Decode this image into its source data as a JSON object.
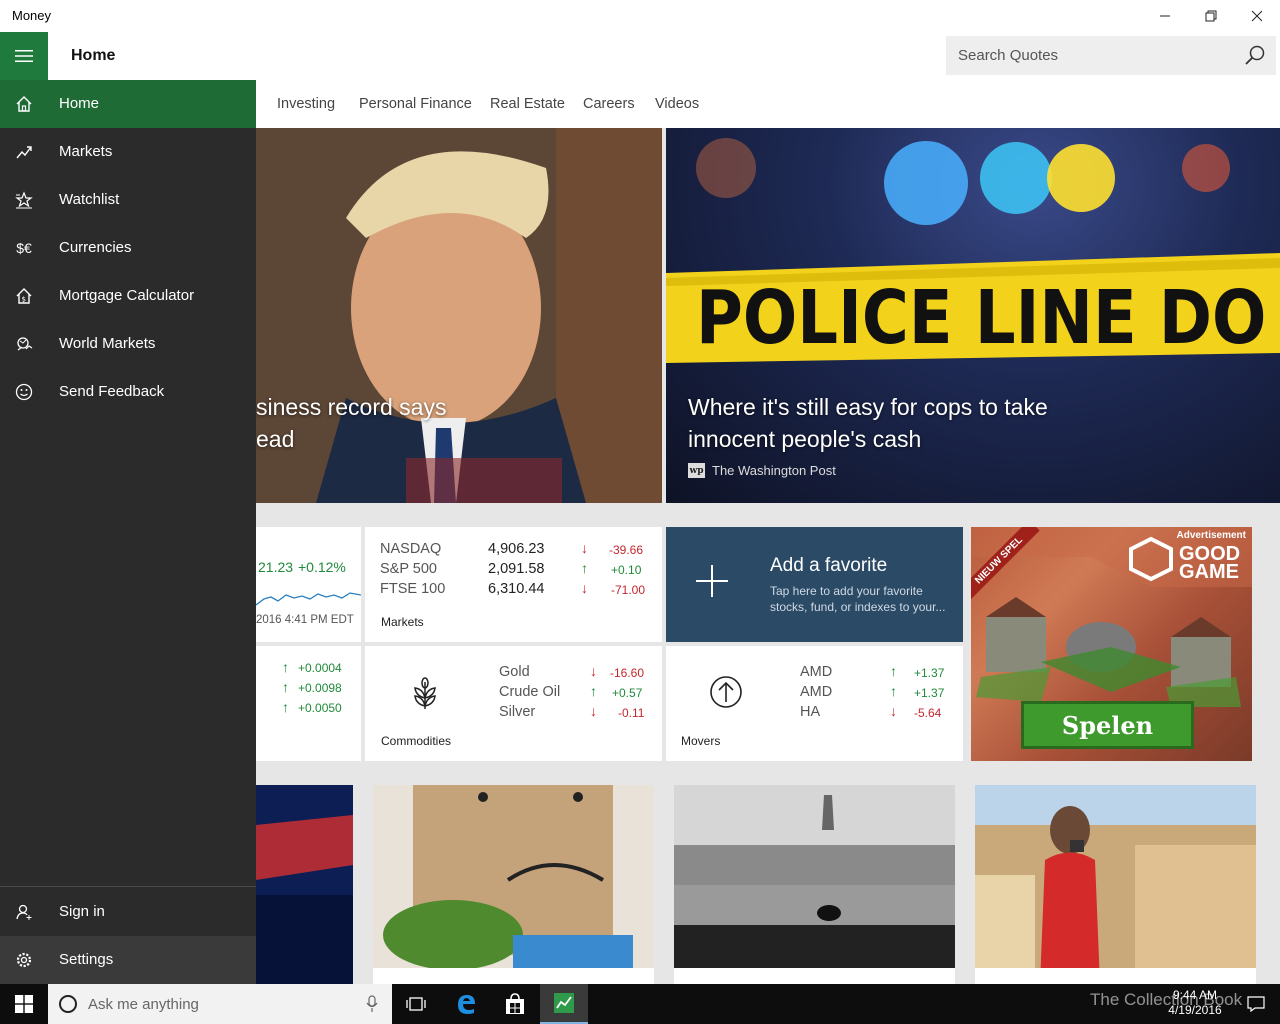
{
  "window": {
    "title": "Money"
  },
  "header": {
    "page_title": "Home",
    "search_placeholder": "Search Quotes"
  },
  "subnav": [
    "Investing",
    "Personal Finance",
    "Real Estate",
    "Careers",
    "Videos"
  ],
  "hero": [
    {
      "caption_line1": "siness record says",
      "caption_line2": "ead"
    },
    {
      "caption_line1": "Where it's still easy for cops to take",
      "caption_line2": "innocent people's cash",
      "source": "The Washington Post",
      "source_logo": "wp"
    }
  ],
  "hero_image_text": "POLICE LINE DO NOT CR",
  "index_tile": {
    "value": "21.23",
    "change": "+0.12%",
    "timestamp": "2016 4:41 PM EDT"
  },
  "markets_tile": {
    "label": "Markets",
    "rows": [
      {
        "name": "NASDAQ",
        "value": "4,906.23",
        "change": "-39.66",
        "dir": "down"
      },
      {
        "name": "S&P 500",
        "value": "2,091.58",
        "change": "+0.10",
        "dir": "up"
      },
      {
        "name": "FTSE 100",
        "value": "6,310.44",
        "change": "-71.00",
        "dir": "down"
      }
    ]
  },
  "favorite_tile": {
    "title": "Add a favorite",
    "desc": "Tap here to add your favorite stocks, fund, or indexes to your..."
  },
  "currency_tile": {
    "rows": [
      "+0.0004",
      "+0.0098",
      "+0.0050"
    ]
  },
  "commodities_tile": {
    "label": "Commodities",
    "rows": [
      {
        "name": "Gold",
        "change": "-16.60",
        "dir": "down"
      },
      {
        "name": "Crude Oil",
        "change": "+0.57",
        "dir": "up"
      },
      {
        "name": "Silver",
        "change": "-0.11",
        "dir": "down"
      }
    ]
  },
  "movers_tile": {
    "label": "Movers",
    "rows": [
      {
        "name": "AMD",
        "change": "+1.37",
        "dir": "up"
      },
      {
        "name": "AMD",
        "change": "+1.37",
        "dir": "up"
      },
      {
        "name": "HA",
        "change": "-5.64",
        "dir": "down"
      }
    ]
  },
  "ad": {
    "label": "Advertisement",
    "brand_line1": "GOOD",
    "brand_line2": "GAME",
    "ribbon": "NIEUW SPEL",
    "button": "Spelen"
  },
  "sidebar": {
    "items": [
      {
        "label": "Home",
        "icon": "home-icon",
        "active": true
      },
      {
        "label": "Markets",
        "icon": "chart-icon"
      },
      {
        "label": "Watchlist",
        "icon": "watchlist-icon"
      },
      {
        "label": "Currencies",
        "icon": "currency-icon"
      },
      {
        "label": "Mortgage Calculator",
        "icon": "mortgage-icon"
      },
      {
        "label": "World Markets",
        "icon": "world-markets-icon"
      },
      {
        "label": "Send Feedback",
        "icon": "smiley-icon"
      }
    ],
    "sign_in": "Sign in",
    "settings": "Settings"
  },
  "taskbar": {
    "search_placeholder": "Ask me anything",
    "time": "9:44 AM",
    "date": "4/19/2016",
    "watermark": "The Collection Book"
  },
  "colors": {
    "accent": "#1f7a3d",
    "sidebar_bg": "#2b2b2b",
    "favorite_bg": "#2b4a66",
    "negative": "#c4262e",
    "positive": "#1f8a3a"
  }
}
